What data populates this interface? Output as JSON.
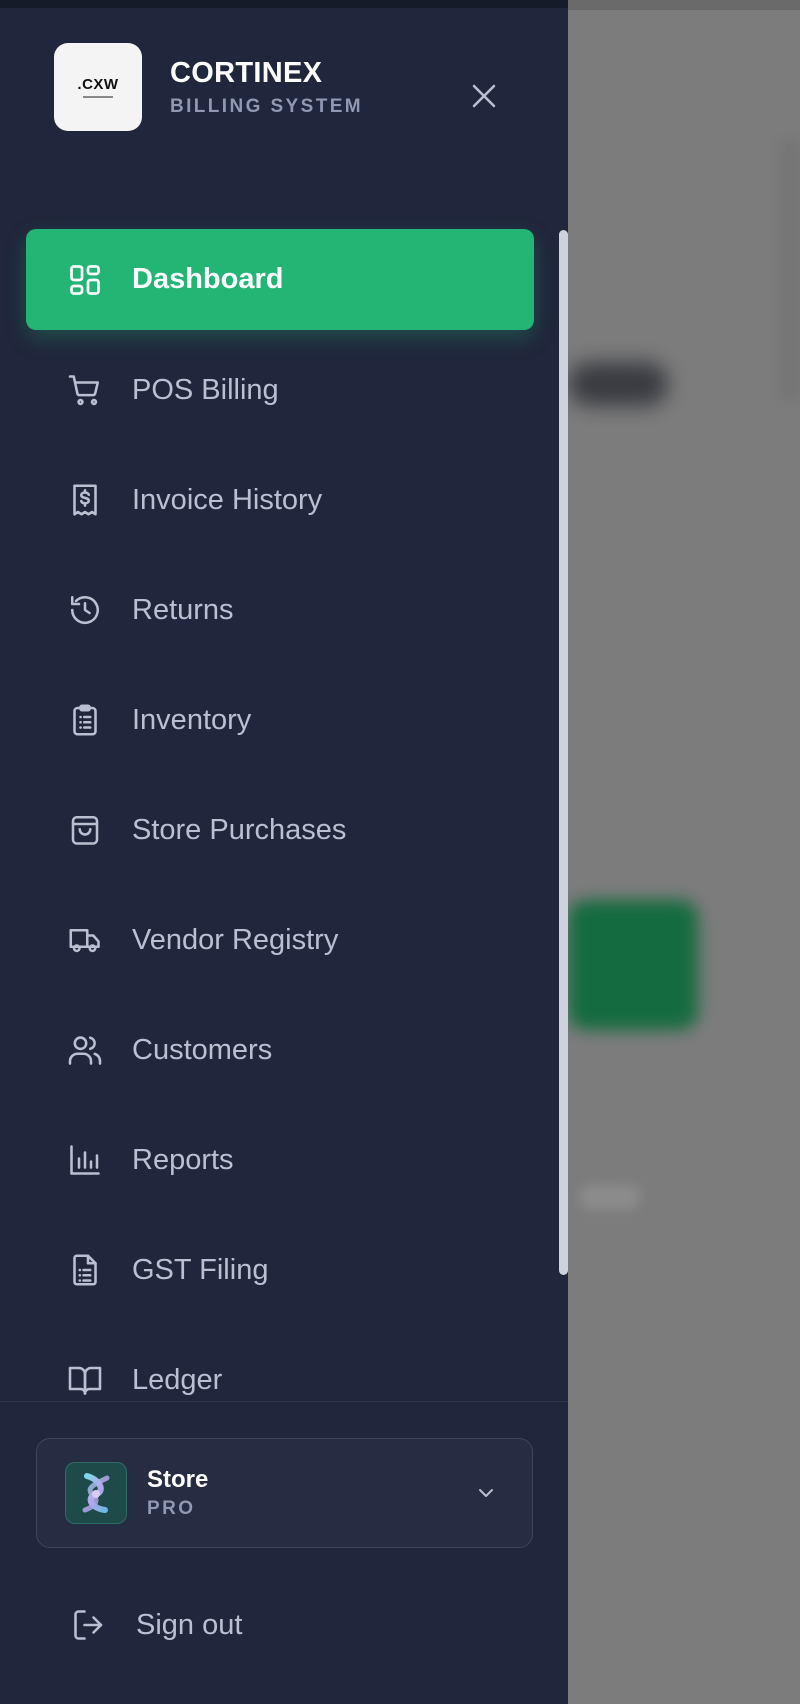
{
  "brand": {
    "logo_text": ".CXW",
    "name": "CORTINEX",
    "subtitle": "BILLING SYSTEM"
  },
  "nav": {
    "items": [
      {
        "label": "Dashboard",
        "icon": "dashboard-grid-icon",
        "active": true
      },
      {
        "label": "POS Billing",
        "icon": "shopping-cart-icon"
      },
      {
        "label": "Invoice History",
        "icon": "receipt-dollar-icon"
      },
      {
        "label": "Returns",
        "icon": "history-icon"
      },
      {
        "label": "Inventory",
        "icon": "clipboard-list-icon"
      },
      {
        "label": "Store Purchases",
        "icon": "shopping-bag-icon"
      },
      {
        "label": "Vendor Registry",
        "icon": "truck-icon"
      },
      {
        "label": "Customers",
        "icon": "users-icon"
      },
      {
        "label": "Reports",
        "icon": "bar-chart-icon"
      },
      {
        "label": "GST Filing",
        "icon": "file-text-icon"
      },
      {
        "label": "Ledger",
        "icon": "book-open-icon"
      }
    ]
  },
  "store": {
    "name": "Store",
    "plan": "PRO"
  },
  "signout": {
    "label": "Sign out"
  },
  "colors": {
    "drawer_bg": "#20263b",
    "active_bg": "#23b574",
    "text_muted": "#b9c0d2",
    "backdrop": "#7c7c7c"
  }
}
